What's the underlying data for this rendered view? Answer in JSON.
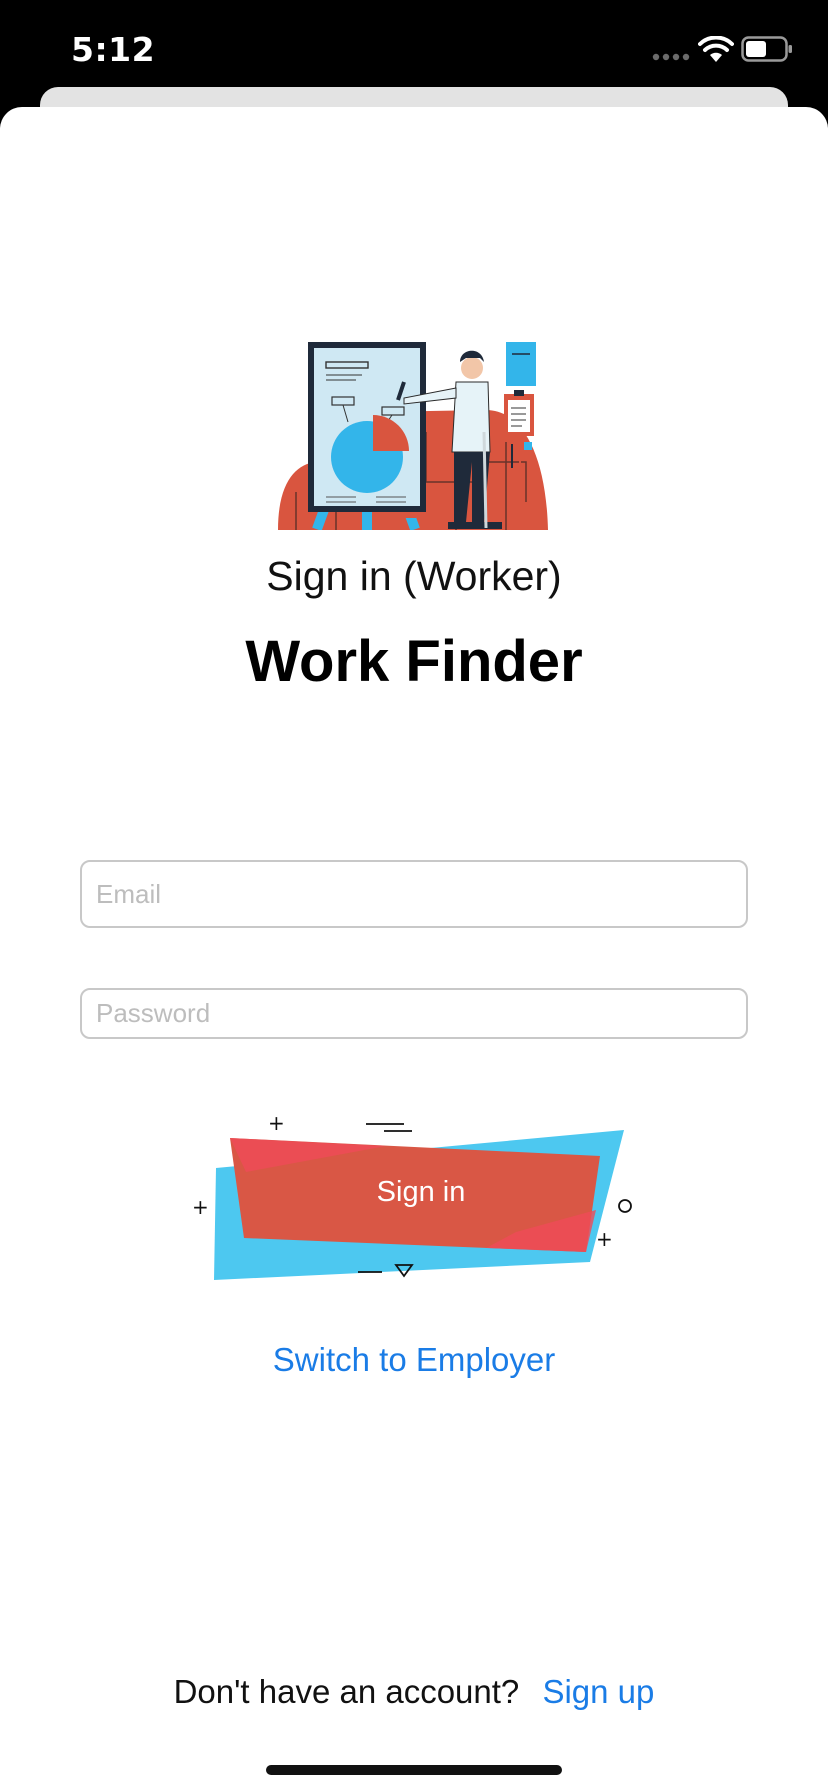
{
  "status_bar": {
    "time": "5:12"
  },
  "header": {
    "subtitle": "Sign in (Worker)",
    "app_title": "Work Finder"
  },
  "form": {
    "email_placeholder": "Email",
    "password_placeholder": "Password",
    "signin_label": "Sign in"
  },
  "links": {
    "switch_role": "Switch to Employer",
    "footer_prompt": "Don't have an account?",
    "signup": "Sign up"
  },
  "icons": {
    "signal": "cellular-signal-icon",
    "wifi": "wifi-icon",
    "battery": "battery-icon",
    "illustration": "presenter-illustration"
  },
  "colors": {
    "accent_link": "#1a7ce6",
    "button_red": "#d95745",
    "button_blue": "#4dc8f0",
    "illustration_orange": "#d9553f"
  }
}
